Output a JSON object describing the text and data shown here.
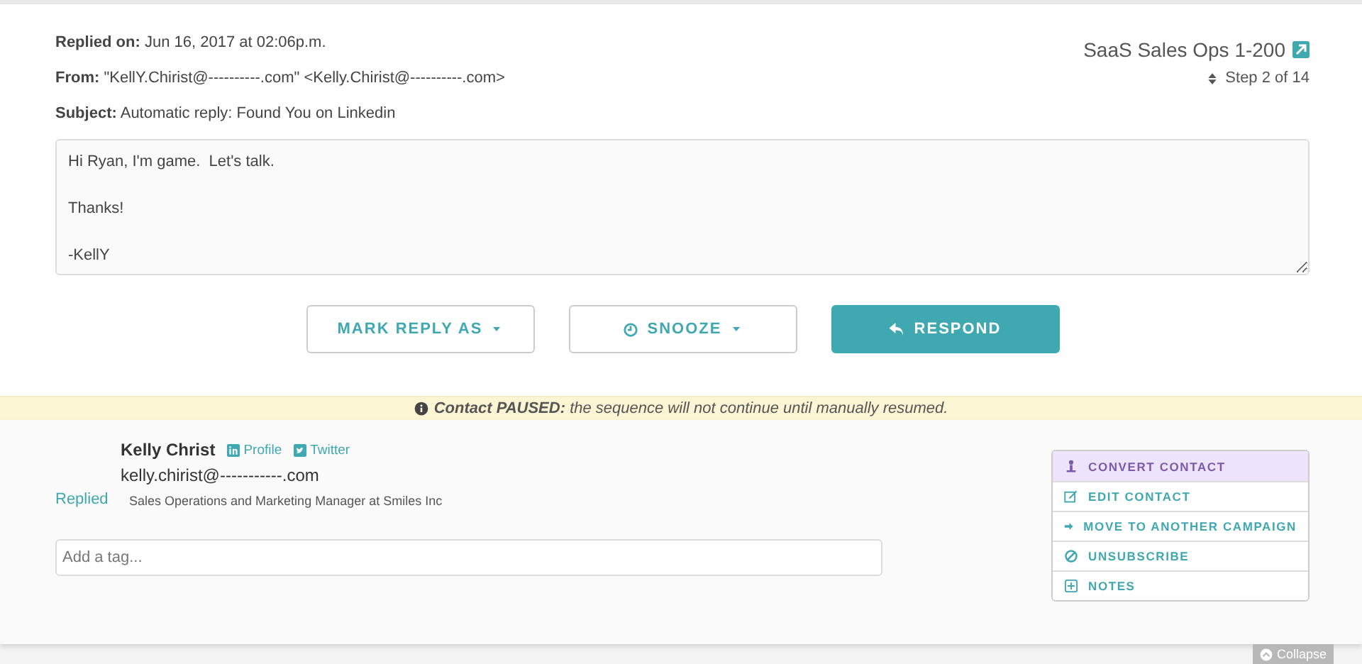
{
  "reply": {
    "meta": [
      "**Replied on:** Jun 16, 2017 at 02:06p.m.",
      "**From:** \"KellY.Chirist@----------.com\" <Kelly.Chirist@----------.com>",
      "**Subject:** Automatic reply: Found You on Linkedin"
    ],
    "campaign": "SaaS Sales Ops 1-200",
    "step": "Step 2 of 14",
    "body": "Hi Ryan, I'm game.  Let's talk.\n\nThanks!\n\n-KellY"
  },
  "buttons": [
    {
      "kind": "mark",
      "label": "MARK REPLY AS"
    },
    {
      "kind": "snooze",
      "label": "SNOOZE"
    },
    {
      "kind": "respond",
      "label": "RESPOND"
    }
  ],
  "banner": "**Contact PAUSED:** the sequence will not continue until manually resumed.",
  "contact": {
    "name": "Kelly Christ",
    "links": [
      {
        "kind": "linkedin",
        "label": "Profile"
      },
      {
        "kind": "twitter",
        "label": "Twitter"
      }
    ],
    "email": "kelly.chirist@-----------.com",
    "status": "Replied",
    "title": "Sales Operations and Marketing Manager at Smiles Inc",
    "tag_placeholder": "Add a tag..."
  },
  "actions": [
    {
      "kind": "convert",
      "label": "CONVERT CONTACT"
    },
    {
      "kind": "edit",
      "label": "EDIT CONTACT"
    },
    {
      "kind": "move",
      "label": "MOVE TO ANOTHER CAMPAIGN"
    },
    {
      "kind": "unsubscribe",
      "label": "UNSUBSCRIBE"
    },
    {
      "kind": "notes",
      "label": "NOTES"
    }
  ],
  "collapse": "Collapse"
}
